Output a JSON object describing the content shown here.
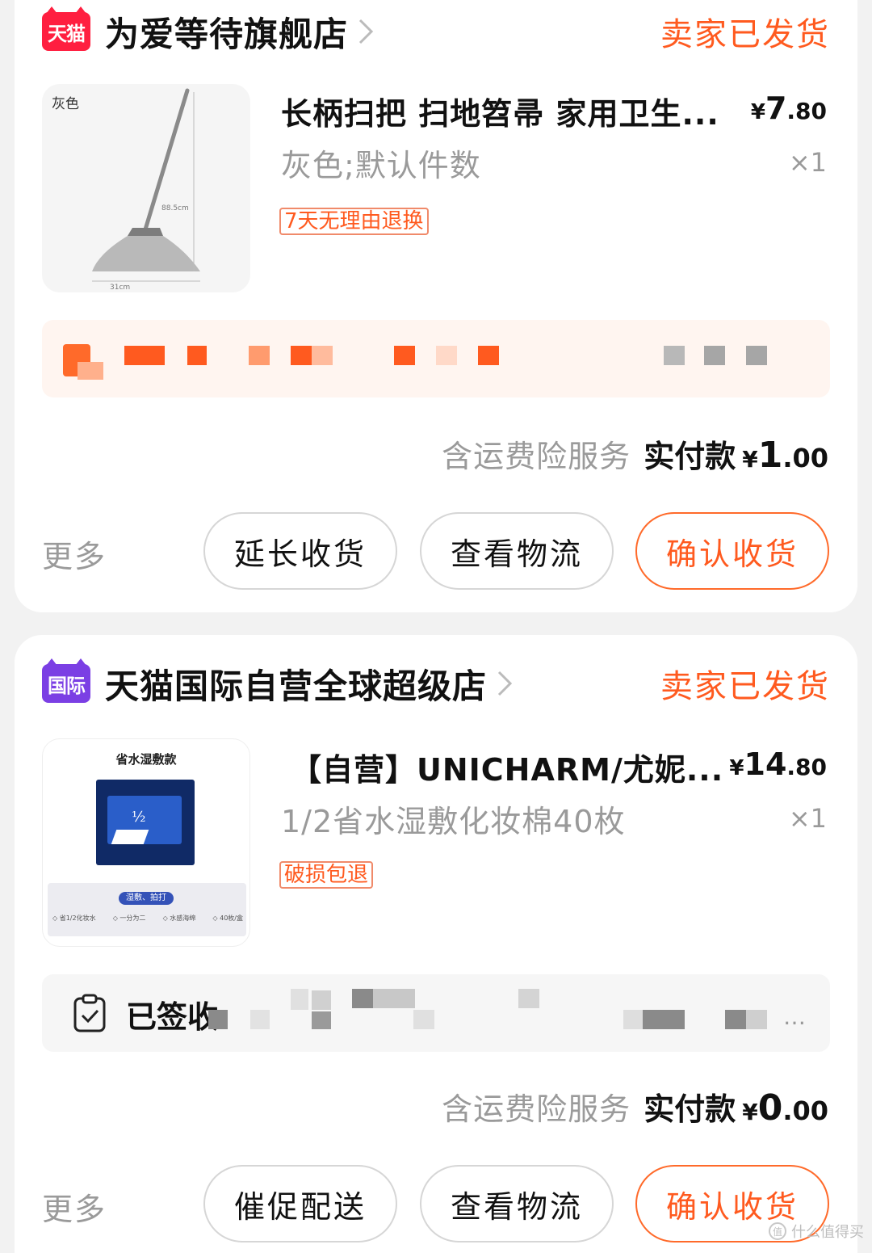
{
  "orders": [
    {
      "shop_badge": "天猫",
      "shop_name": "为爱等待旗舰店",
      "status": "卖家已发货",
      "image_label": "灰色",
      "image_dims": [
        "88.5cm",
        "31cm"
      ],
      "title": "长柄扫把 扫地笤帚 家用卫生...",
      "price_currency": "¥",
      "price_int": "7",
      "price_dec": ".80",
      "sku": "灰色;默认件数",
      "quantity": "×1",
      "tag": "7天无理由退换",
      "service_note": "含运费险服务",
      "paid_label": "实付款",
      "paid_currency": "¥",
      "paid_int": "1",
      "paid_dec": ".00",
      "more_label": "更多",
      "buttons": [
        "延长收货",
        "查看物流",
        "确认收货"
      ]
    },
    {
      "shop_badge": "国际",
      "shop_name": "天猫国际自营全球超级店",
      "status": "卖家已发货",
      "image_label": "省水湿敷款",
      "image_pill": "湿敷、拍打",
      "image_features": [
        "◇ 省1/2化妆水",
        "◇ 一分为二",
        "◇ 水感海绵",
        "◇ 40枚/盒"
      ],
      "title": "【自营】UNICHARM/尤妮...",
      "price_currency": "¥",
      "price_int": "14",
      "price_dec": ".80",
      "sku": "1/2省水湿敷化妆棉40枚",
      "quantity": "×1",
      "tag": "破损包退",
      "logistics_status": "已签收",
      "service_note": "含运费险服务",
      "paid_label": "实付款",
      "paid_currency": "¥",
      "paid_int": "0",
      "paid_dec": ".00",
      "more_label": "更多",
      "buttons": [
        "催促配送",
        "查看物流",
        "确认收货"
      ]
    }
  ],
  "watermark": "什么值得买",
  "colors": {
    "accent": "#ff5a1f",
    "tmall_red": "#ff1f40",
    "intl_purple": "#7b3fe4"
  }
}
